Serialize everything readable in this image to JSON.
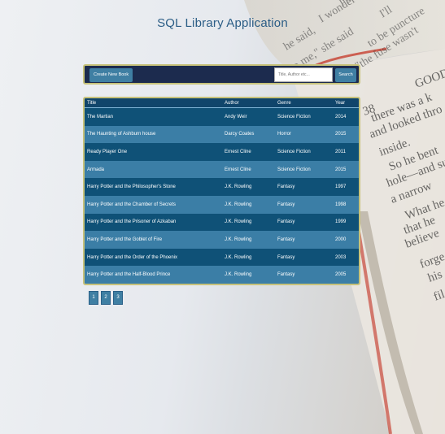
{
  "app": {
    "title": "SQL Library Application"
  },
  "toolbar": {
    "create_label": "Create New Book",
    "search_placeholder": "Title, Author etc...",
    "search_value": "",
    "search_label": "Search"
  },
  "table": {
    "headers": [
      "Title",
      "Author",
      "Genre",
      "Year"
    ],
    "rows": [
      [
        "The Martian",
        "Andy Weir",
        "Science Fiction",
        "2014"
      ],
      [
        "The Haunting of Ashburn house",
        "Darcy Coates",
        "Horror",
        "2015"
      ],
      [
        "Ready Player One",
        "Ernest Cline",
        "Science Fiction",
        "2011"
      ],
      [
        "Armada",
        "Ernest Cline",
        "Science Fiction",
        "2015"
      ],
      [
        "Harry Potter and the Philosopher's Stone",
        "J.K. Rowling",
        "Fantasy",
        "1997"
      ],
      [
        "Harry Potter and the Chamber of Secrets",
        "J.K. Rowling",
        "Fantasy",
        "1998"
      ],
      [
        "Harry Potter and the Prisoner of Azkaban",
        "J.K. Rowling",
        "Fantasy",
        "1999"
      ],
      [
        "Harry Potter and the Goblet of Fire",
        "J.K. Rowling",
        "Fantasy",
        "2000"
      ],
      [
        "Harry Potter and the Order of the Phoenix",
        "J.K. Rowling",
        "Fantasy",
        "2003"
      ],
      [
        "Harry Potter and the Half-Blood Prince",
        "J.K. Rowling",
        "Fantasy",
        "2005"
      ]
    ]
  },
  "pagination": {
    "pages": [
      "1",
      "2",
      "3"
    ]
  },
  "background_book": {
    "page_lines": [
      "I'm sure",
      "I wonder if it",
      "I'll",
      "he said,",
      "to be puncture",
      "to me,\" she said",
      "\"the fuse wasn't",
      "GOOD",
      "there was a k",
      "and looked thro",
      "inside.",
      "So he bent",
      "hole—and sure",
      "a narrow",
      "What he",
      "that he",
      "believe",
      "forge",
      "his",
      "fil"
    ],
    "page_number": "38"
  },
  "colors": {
    "navy": "#1c2b4e",
    "accent": "#3f7fa3",
    "row_dark": "#0f5177",
    "row_light": "#3b7ea6",
    "border_gold": "#c7c27a",
    "title": "#2b5d86"
  }
}
